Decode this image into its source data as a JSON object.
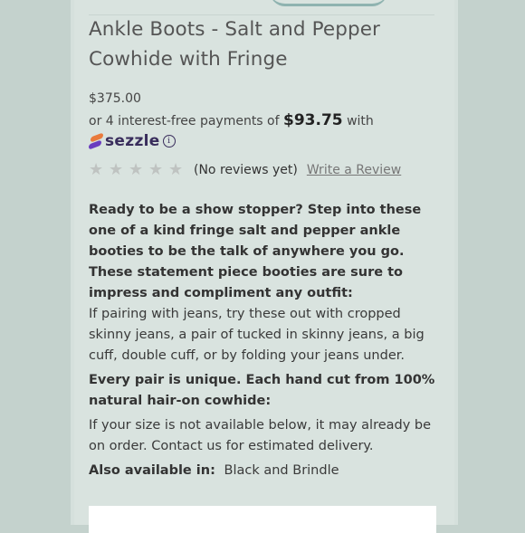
{
  "product": {
    "title": "Ankle Boots - Salt and Pepper Cowhide with Fringe",
    "price": "$375.00",
    "installments_prefix": "or 4 interest-free payments of",
    "installments_amount": "$93.75",
    "installments_suffix": "with",
    "sezzle_label": "sezzle",
    "info_symbol": "i"
  },
  "reviews": {
    "rating": 0,
    "max": 5,
    "count_text": "(No reviews yet)",
    "write_label": "Write a Review"
  },
  "description": {
    "intro": "Ready to be a show stopper? Step into these one of a kind fringe salt and pepper ankle booties to be the talk of anywhere you go. These statement piece booties are sure to impress and compliment any outfit:",
    "pairing": "If pairing with jeans, try these out with cropped skinny jeans, a pair of tucked in skinny jeans, a big cuff, double cuff, or by folding your jeans under.",
    "unique": "Every pair is unique. Each hand cut from 100% natural hair-on cowhide:",
    "availability": "If your size is not available below, it may already be on order. Contact us for estimated delivery.",
    "also_label": "Also available in:",
    "also_value": "Black and Brindle"
  },
  "icons": {
    "star": "star-icon",
    "sezzle": "sezzle-logo-icon",
    "info": "info-icon"
  }
}
